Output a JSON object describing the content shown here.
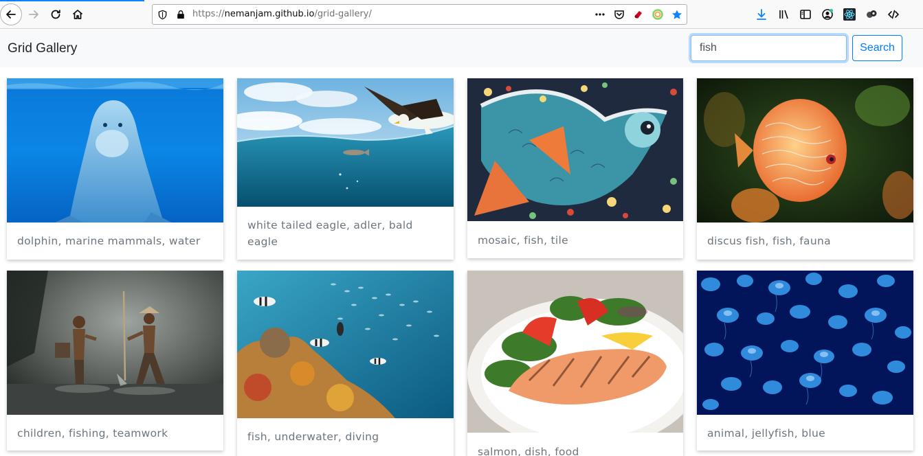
{
  "browser": {
    "url_prefix": "https://",
    "url_host": "nemanjam.github.io",
    "url_path": "/grid-gallery/",
    "icons": {
      "back": "back-arrow-icon",
      "forward": "forward-arrow-icon",
      "reload": "reload-icon",
      "home": "home-icon",
      "shield": "tracking-protection-shield-icon",
      "lock": "lock-icon",
      "more": "page-actions-more-icon",
      "pocket": "pocket-icon",
      "bookmark": "bookmark-star-icon",
      "download": "download-icon",
      "library": "library-icon",
      "sidebar": "sidebar-icon",
      "account": "account-icon",
      "react": "react-devtools-icon",
      "extension": "extension-icon",
      "devtools": "devtools-code-icon"
    },
    "accent": "#0a84ff"
  },
  "navbar": {
    "brand": "Grid Gallery",
    "search_value": "fish",
    "search_button": "Search",
    "accent": "#007bff"
  },
  "gallery": {
    "cards": [
      {
        "caption": "dolphin, marine mammals, water",
        "image": "dolphin underwater"
      },
      {
        "caption": "white tailed eagle, adler, bald eagle",
        "image": "eagle over sea"
      },
      {
        "caption": "mosaic, fish, tile",
        "image": "mosaic fish tile"
      },
      {
        "caption": "discus fish, fish, fauna",
        "image": "discus fish"
      },
      {
        "caption": "children, fishing, teamwork",
        "image": "children fishing"
      },
      {
        "caption": "fish, underwater, diving",
        "image": "coral reef fish"
      },
      {
        "caption": "salmon, dish, food",
        "image": "salmon dish"
      },
      {
        "caption": "animal, jellyfish, blue",
        "image": "jellyfish"
      }
    ]
  }
}
